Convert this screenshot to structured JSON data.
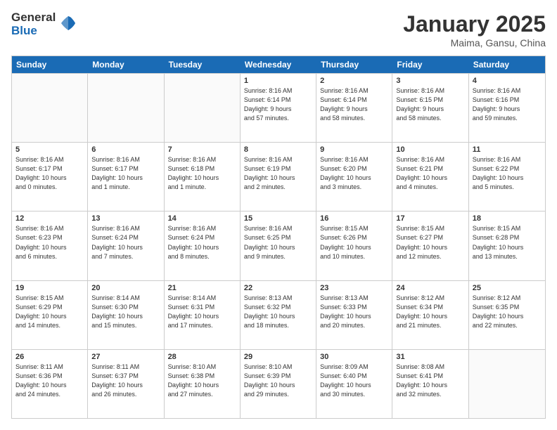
{
  "logo": {
    "general": "General",
    "blue": "Blue"
  },
  "title": "January 2025",
  "location": "Maima, Gansu, China",
  "header_days": [
    "Sunday",
    "Monday",
    "Tuesday",
    "Wednesday",
    "Thursday",
    "Friday",
    "Saturday"
  ],
  "weeks": [
    [
      {
        "day": "",
        "info": ""
      },
      {
        "day": "",
        "info": ""
      },
      {
        "day": "",
        "info": ""
      },
      {
        "day": "1",
        "info": "Sunrise: 8:16 AM\nSunset: 6:14 PM\nDaylight: 9 hours\nand 57 minutes."
      },
      {
        "day": "2",
        "info": "Sunrise: 8:16 AM\nSunset: 6:14 PM\nDaylight: 9 hours\nand 58 minutes."
      },
      {
        "day": "3",
        "info": "Sunrise: 8:16 AM\nSunset: 6:15 PM\nDaylight: 9 hours\nand 58 minutes."
      },
      {
        "day": "4",
        "info": "Sunrise: 8:16 AM\nSunset: 6:16 PM\nDaylight: 9 hours\nand 59 minutes."
      }
    ],
    [
      {
        "day": "5",
        "info": "Sunrise: 8:16 AM\nSunset: 6:17 PM\nDaylight: 10 hours\nand 0 minutes."
      },
      {
        "day": "6",
        "info": "Sunrise: 8:16 AM\nSunset: 6:17 PM\nDaylight: 10 hours\nand 1 minute."
      },
      {
        "day": "7",
        "info": "Sunrise: 8:16 AM\nSunset: 6:18 PM\nDaylight: 10 hours\nand 1 minute."
      },
      {
        "day": "8",
        "info": "Sunrise: 8:16 AM\nSunset: 6:19 PM\nDaylight: 10 hours\nand 2 minutes."
      },
      {
        "day": "9",
        "info": "Sunrise: 8:16 AM\nSunset: 6:20 PM\nDaylight: 10 hours\nand 3 minutes."
      },
      {
        "day": "10",
        "info": "Sunrise: 8:16 AM\nSunset: 6:21 PM\nDaylight: 10 hours\nand 4 minutes."
      },
      {
        "day": "11",
        "info": "Sunrise: 8:16 AM\nSunset: 6:22 PM\nDaylight: 10 hours\nand 5 minutes."
      }
    ],
    [
      {
        "day": "12",
        "info": "Sunrise: 8:16 AM\nSunset: 6:23 PM\nDaylight: 10 hours\nand 6 minutes."
      },
      {
        "day": "13",
        "info": "Sunrise: 8:16 AM\nSunset: 6:24 PM\nDaylight: 10 hours\nand 7 minutes."
      },
      {
        "day": "14",
        "info": "Sunrise: 8:16 AM\nSunset: 6:24 PM\nDaylight: 10 hours\nand 8 minutes."
      },
      {
        "day": "15",
        "info": "Sunrise: 8:16 AM\nSunset: 6:25 PM\nDaylight: 10 hours\nand 9 minutes."
      },
      {
        "day": "16",
        "info": "Sunrise: 8:15 AM\nSunset: 6:26 PM\nDaylight: 10 hours\nand 10 minutes."
      },
      {
        "day": "17",
        "info": "Sunrise: 8:15 AM\nSunset: 6:27 PM\nDaylight: 10 hours\nand 12 minutes."
      },
      {
        "day": "18",
        "info": "Sunrise: 8:15 AM\nSunset: 6:28 PM\nDaylight: 10 hours\nand 13 minutes."
      }
    ],
    [
      {
        "day": "19",
        "info": "Sunrise: 8:15 AM\nSunset: 6:29 PM\nDaylight: 10 hours\nand 14 minutes."
      },
      {
        "day": "20",
        "info": "Sunrise: 8:14 AM\nSunset: 6:30 PM\nDaylight: 10 hours\nand 15 minutes."
      },
      {
        "day": "21",
        "info": "Sunrise: 8:14 AM\nSunset: 6:31 PM\nDaylight: 10 hours\nand 17 minutes."
      },
      {
        "day": "22",
        "info": "Sunrise: 8:13 AM\nSunset: 6:32 PM\nDaylight: 10 hours\nand 18 minutes."
      },
      {
        "day": "23",
        "info": "Sunrise: 8:13 AM\nSunset: 6:33 PM\nDaylight: 10 hours\nand 20 minutes."
      },
      {
        "day": "24",
        "info": "Sunrise: 8:12 AM\nSunset: 6:34 PM\nDaylight: 10 hours\nand 21 minutes."
      },
      {
        "day": "25",
        "info": "Sunrise: 8:12 AM\nSunset: 6:35 PM\nDaylight: 10 hours\nand 22 minutes."
      }
    ],
    [
      {
        "day": "26",
        "info": "Sunrise: 8:11 AM\nSunset: 6:36 PM\nDaylight: 10 hours\nand 24 minutes."
      },
      {
        "day": "27",
        "info": "Sunrise: 8:11 AM\nSunset: 6:37 PM\nDaylight: 10 hours\nand 26 minutes."
      },
      {
        "day": "28",
        "info": "Sunrise: 8:10 AM\nSunset: 6:38 PM\nDaylight: 10 hours\nand 27 minutes."
      },
      {
        "day": "29",
        "info": "Sunrise: 8:10 AM\nSunset: 6:39 PM\nDaylight: 10 hours\nand 29 minutes."
      },
      {
        "day": "30",
        "info": "Sunrise: 8:09 AM\nSunset: 6:40 PM\nDaylight: 10 hours\nand 30 minutes."
      },
      {
        "day": "31",
        "info": "Sunrise: 8:08 AM\nSunset: 6:41 PM\nDaylight: 10 hours\nand 32 minutes."
      },
      {
        "day": "",
        "info": ""
      }
    ]
  ]
}
